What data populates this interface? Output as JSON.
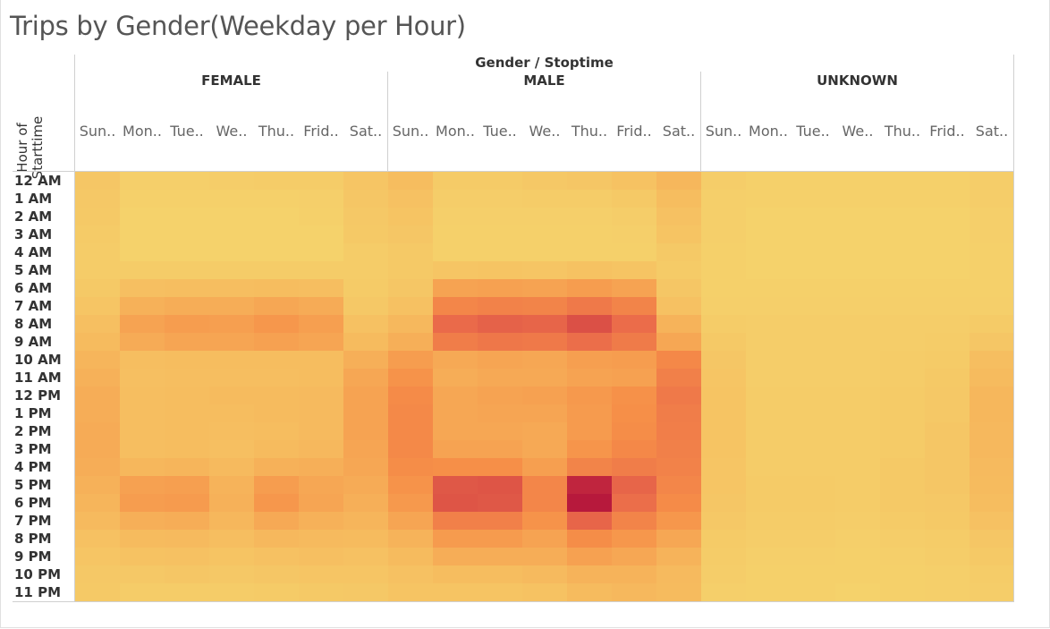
{
  "page": {
    "title": "Trips by Gender(Weekday per Hour)",
    "column_header": "Gender / Stoptime",
    "row_header": "Hour of Starttime"
  },
  "chart_data": {
    "type": "heatmap",
    "title": "Trips by Gender(Weekday per Hour)",
    "xlabel": "Gender / Stoptime",
    "ylabel": "Hour of Starttime",
    "groups": [
      "FEMALE",
      "MALE",
      "UNKNOWN"
    ],
    "days": [
      "Sun..",
      "Mon..",
      "Tue..",
      "We..",
      "Thu..",
      "Frid..",
      "Sat.."
    ],
    "hours": [
      "12 AM",
      "1 AM",
      "2 AM",
      "3 AM",
      "4 AM",
      "5 AM",
      "6 AM",
      "7 AM",
      "8 AM",
      "9 AM",
      "10 AM",
      "11 AM",
      "12 PM",
      "1 PM",
      "2 PM",
      "3 PM",
      "4 PM",
      "5 PM",
      "6 PM",
      "7 PM",
      "8 PM",
      "9 PM",
      "10 PM",
      "11 PM"
    ],
    "color_scale": [
      "#f5d36c",
      "#f6b75c",
      "#f68f48",
      "#ea6a4a",
      "#c4293f",
      "#b2133b"
    ],
    "intensity": {
      "FEMALE": [
        [
          0.09,
          0.03,
          0.03,
          0.04,
          0.05,
          0.05,
          0.1
        ],
        [
          0.08,
          0.02,
          0.02,
          0.02,
          0.02,
          0.03,
          0.09
        ],
        [
          0.07,
          0.01,
          0.01,
          0.01,
          0.01,
          0.02,
          0.08
        ],
        [
          0.06,
          0.01,
          0.01,
          0.01,
          0.01,
          0.01,
          0.07
        ],
        [
          0.05,
          0.01,
          0.01,
          0.01,
          0.01,
          0.01,
          0.05
        ],
        [
          0.05,
          0.05,
          0.05,
          0.05,
          0.05,
          0.05,
          0.05
        ],
        [
          0.07,
          0.14,
          0.15,
          0.15,
          0.16,
          0.15,
          0.06
        ],
        [
          0.1,
          0.23,
          0.25,
          0.25,
          0.28,
          0.26,
          0.08
        ],
        [
          0.14,
          0.3,
          0.33,
          0.32,
          0.36,
          0.32,
          0.13
        ],
        [
          0.17,
          0.26,
          0.29,
          0.29,
          0.31,
          0.29,
          0.17
        ],
        [
          0.21,
          0.15,
          0.16,
          0.16,
          0.16,
          0.16,
          0.24
        ],
        [
          0.23,
          0.14,
          0.15,
          0.15,
          0.15,
          0.16,
          0.28
        ],
        [
          0.25,
          0.15,
          0.16,
          0.17,
          0.17,
          0.18,
          0.3
        ],
        [
          0.25,
          0.15,
          0.16,
          0.16,
          0.17,
          0.18,
          0.3
        ],
        [
          0.26,
          0.15,
          0.16,
          0.15,
          0.16,
          0.18,
          0.3
        ],
        [
          0.26,
          0.15,
          0.16,
          0.14,
          0.17,
          0.19,
          0.29
        ],
        [
          0.25,
          0.2,
          0.21,
          0.18,
          0.23,
          0.24,
          0.28
        ],
        [
          0.23,
          0.31,
          0.32,
          0.22,
          0.33,
          0.28,
          0.26
        ],
        [
          0.21,
          0.33,
          0.34,
          0.23,
          0.36,
          0.29,
          0.24
        ],
        [
          0.18,
          0.24,
          0.25,
          0.2,
          0.27,
          0.23,
          0.21
        ],
        [
          0.13,
          0.17,
          0.18,
          0.15,
          0.19,
          0.18,
          0.17
        ],
        [
          0.1,
          0.12,
          0.13,
          0.11,
          0.13,
          0.14,
          0.13
        ],
        [
          0.08,
          0.08,
          0.09,
          0.08,
          0.09,
          0.1,
          0.1
        ],
        [
          0.07,
          0.05,
          0.05,
          0.05,
          0.06,
          0.07,
          0.08
        ]
      ],
      "MALE": [
        [
          0.16,
          0.06,
          0.06,
          0.08,
          0.09,
          0.12,
          0.2
        ],
        [
          0.13,
          0.04,
          0.04,
          0.05,
          0.05,
          0.07,
          0.16
        ],
        [
          0.11,
          0.03,
          0.03,
          0.03,
          0.03,
          0.04,
          0.13
        ],
        [
          0.09,
          0.02,
          0.02,
          0.02,
          0.02,
          0.03,
          0.11
        ],
        [
          0.07,
          0.02,
          0.02,
          0.02,
          0.02,
          0.02,
          0.07
        ],
        [
          0.07,
          0.1,
          0.11,
          0.1,
          0.12,
          0.11,
          0.06
        ],
        [
          0.09,
          0.3,
          0.31,
          0.3,
          0.33,
          0.3,
          0.09
        ],
        [
          0.13,
          0.45,
          0.47,
          0.46,
          0.52,
          0.46,
          0.13
        ],
        [
          0.19,
          0.6,
          0.63,
          0.62,
          0.7,
          0.59,
          0.22
        ],
        [
          0.24,
          0.5,
          0.53,
          0.52,
          0.58,
          0.51,
          0.28
        ],
        [
          0.33,
          0.27,
          0.29,
          0.28,
          0.32,
          0.33,
          0.44
        ],
        [
          0.38,
          0.25,
          0.27,
          0.27,
          0.3,
          0.31,
          0.48
        ],
        [
          0.42,
          0.28,
          0.3,
          0.31,
          0.35,
          0.39,
          0.52
        ],
        [
          0.43,
          0.28,
          0.29,
          0.29,
          0.34,
          0.4,
          0.5
        ],
        [
          0.43,
          0.28,
          0.28,
          0.27,
          0.34,
          0.41,
          0.49
        ],
        [
          0.43,
          0.3,
          0.3,
          0.27,
          0.37,
          0.44,
          0.48
        ],
        [
          0.41,
          0.4,
          0.4,
          0.32,
          0.46,
          0.5,
          0.47
        ],
        [
          0.38,
          0.67,
          0.68,
          0.45,
          0.88,
          0.62,
          0.45
        ],
        [
          0.35,
          0.68,
          0.67,
          0.45,
          0.96,
          0.58,
          0.42
        ],
        [
          0.29,
          0.48,
          0.48,
          0.38,
          0.62,
          0.46,
          0.36
        ],
        [
          0.22,
          0.34,
          0.34,
          0.3,
          0.41,
          0.36,
          0.28
        ],
        [
          0.17,
          0.25,
          0.25,
          0.25,
          0.31,
          0.28,
          0.22
        ],
        [
          0.13,
          0.16,
          0.16,
          0.18,
          0.22,
          0.22,
          0.18
        ],
        [
          0.11,
          0.11,
          0.11,
          0.12,
          0.17,
          0.19,
          0.17
        ]
      ],
      "UNKNOWN": [
        [
          0.04,
          0.02,
          0.02,
          0.02,
          0.02,
          0.02,
          0.04
        ],
        [
          0.03,
          0.02,
          0.02,
          0.02,
          0.02,
          0.02,
          0.04
        ],
        [
          0.03,
          0.01,
          0.01,
          0.01,
          0.01,
          0.01,
          0.03
        ],
        [
          0.03,
          0.01,
          0.01,
          0.01,
          0.01,
          0.01,
          0.03
        ],
        [
          0.02,
          0.01,
          0.01,
          0.01,
          0.01,
          0.01,
          0.02
        ],
        [
          0.02,
          0.01,
          0.01,
          0.01,
          0.01,
          0.01,
          0.02
        ],
        [
          0.02,
          0.02,
          0.02,
          0.02,
          0.02,
          0.02,
          0.02
        ],
        [
          0.03,
          0.03,
          0.03,
          0.03,
          0.03,
          0.03,
          0.03
        ],
        [
          0.05,
          0.04,
          0.04,
          0.04,
          0.04,
          0.04,
          0.06
        ],
        [
          0.07,
          0.04,
          0.04,
          0.04,
          0.04,
          0.05,
          0.09
        ],
        [
          0.09,
          0.04,
          0.04,
          0.04,
          0.05,
          0.06,
          0.15
        ],
        [
          0.1,
          0.04,
          0.04,
          0.04,
          0.05,
          0.07,
          0.17
        ],
        [
          0.11,
          0.05,
          0.05,
          0.05,
          0.06,
          0.08,
          0.2
        ],
        [
          0.11,
          0.05,
          0.05,
          0.05,
          0.06,
          0.08,
          0.2
        ],
        [
          0.11,
          0.05,
          0.05,
          0.05,
          0.06,
          0.09,
          0.19
        ],
        [
          0.11,
          0.05,
          0.05,
          0.05,
          0.06,
          0.09,
          0.19
        ],
        [
          0.1,
          0.05,
          0.05,
          0.05,
          0.07,
          0.09,
          0.18
        ],
        [
          0.1,
          0.06,
          0.06,
          0.05,
          0.07,
          0.09,
          0.17
        ],
        [
          0.09,
          0.06,
          0.06,
          0.05,
          0.07,
          0.08,
          0.16
        ],
        [
          0.08,
          0.05,
          0.05,
          0.04,
          0.06,
          0.07,
          0.13
        ],
        [
          0.06,
          0.04,
          0.04,
          0.03,
          0.04,
          0.05,
          0.09
        ],
        [
          0.05,
          0.03,
          0.03,
          0.02,
          0.03,
          0.04,
          0.07
        ],
        [
          0.04,
          0.02,
          0.02,
          0.02,
          0.02,
          0.03,
          0.05
        ],
        [
          0.03,
          0.02,
          0.02,
          0.01,
          0.02,
          0.03,
          0.04
        ]
      ]
    }
  }
}
